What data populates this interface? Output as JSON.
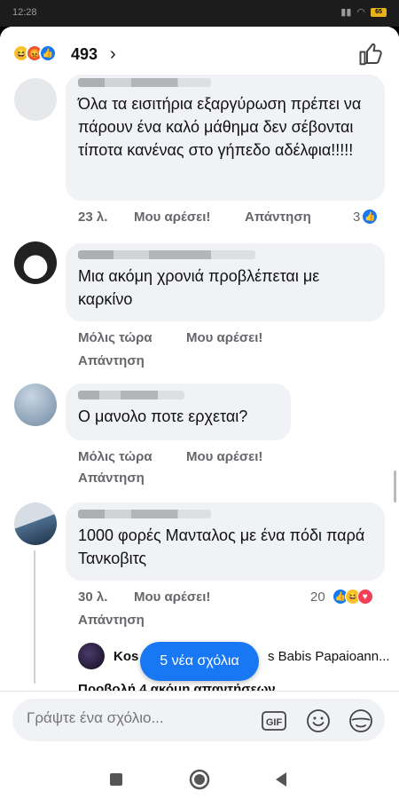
{
  "status_bar": {
    "time": "12:28",
    "battery": "65"
  },
  "header": {
    "reaction_icons": [
      "haha-icon",
      "angry-icon",
      "like-icon"
    ],
    "reaction_count": "493",
    "chevron": "›"
  },
  "comments": [
    {
      "text": "Όλα τα εισιτήρια εξαργύρωση πρέπει να πάρουν ένα καλό μάθημα δεν σέβονται τίποτα κανένας στο γήπεδο αδέλφια!!!!!",
      "time": "23 λ.",
      "like_label": "Μου αρέσει!",
      "reply_label": "Απάντηση",
      "reaction_count": "3"
    },
    {
      "text": "Μια ακόμη χρονιά προβλέπεται με καρκίνο",
      "time": "Μόλις τώρα",
      "like_label": "Μου αρέσει!",
      "reply_label": "Απάντηση"
    },
    {
      "text": "Ο μανολο ποτε ερχεται?",
      "time": "Μόλις τώρα",
      "like_label": "Μου αρέσει!",
      "reply_label": "Απάντηση"
    },
    {
      "text": "1000 φορές Μανταλος με ένα πόδι παρά Τανκοβιτς",
      "time": "30 λ.",
      "like_label": "Μου αρέσει!",
      "reply_label": "Απάντηση",
      "reaction_count": "20"
    }
  ],
  "reply_preview": {
    "name": "Kos",
    "tail": "s Babis Papaioann..."
  },
  "more_replies": "Προβολή 4 ακόμη απαντήσεων",
  "new_comments_pill": "5 νέα σχόλια",
  "composer": {
    "placeholder": "Γράψτε ένα σχόλιο...",
    "gif_label": "GIF"
  },
  "colors": {
    "accent": "#1877f2",
    "bubble": "#f0f2f5",
    "secondary_text": "#65676b"
  }
}
